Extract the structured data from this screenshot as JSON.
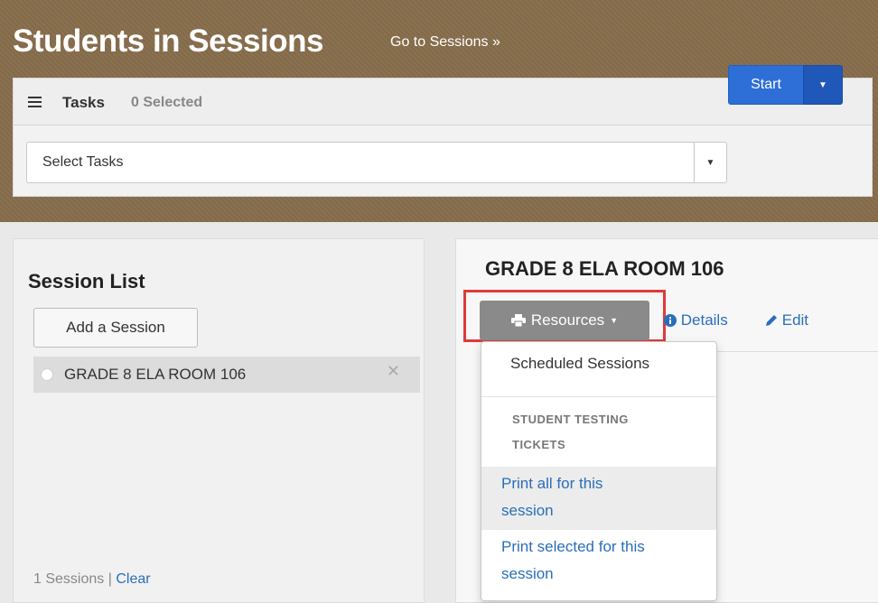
{
  "header": {
    "title": "Students in Sessions",
    "goto_link": "Go to Sessions »"
  },
  "tasks": {
    "label": "Tasks",
    "selected_count": "0 Selected",
    "select_value": "Select Tasks",
    "start_label": "Start"
  },
  "session_list": {
    "title": "Session List",
    "add_button": "Add a Session",
    "items": [
      {
        "label": "GRADE 8 ELA ROOM 106"
      }
    ],
    "footer_count": "1 Sessions |",
    "clear_link": "Clear"
  },
  "session_detail": {
    "title": "GRADE 8 ELA ROOM 106",
    "resources_button": "Resources",
    "details_link": "Details",
    "edit_link": "Edit"
  },
  "resources_menu": {
    "scheduled_sessions": "Scheduled Sessions",
    "section_header_line1": "STUDENT TESTING",
    "section_header_line2": "TICKETS",
    "print_all_line1": "Print all for this",
    "print_all_line2": "session",
    "print_selected_line1": "Print selected for this",
    "print_selected_line2": "session"
  },
  "colors": {
    "header_brown": "#8a7150",
    "start_blue": "#2d6fd6",
    "link_blue": "#2a6ebb",
    "highlight_red": "#e03a3a",
    "resources_gray": "#8a8a8a"
  },
  "icons": [
    "tasks-list-icon",
    "caret-down-icon",
    "close-icon",
    "print-icon",
    "info-icon",
    "pencil-icon"
  ]
}
